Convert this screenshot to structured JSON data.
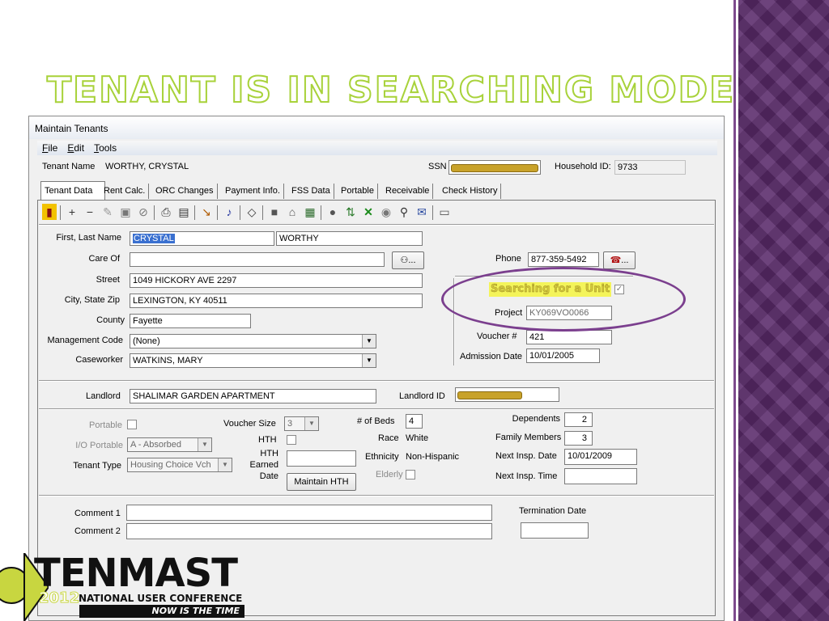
{
  "slide": {
    "title": "Tenant is in Searching Mode"
  },
  "window": {
    "title": "Maintain Tenants"
  },
  "menu": [
    "File",
    "Edit",
    "Tools"
  ],
  "tenant_bar": {
    "name_label": "Tenant Name",
    "name_value": "WORTHY, CRYSTAL",
    "ssn_label": "SSN",
    "household_label": "Household ID:",
    "household_value": "9733"
  },
  "tabs": [
    "Tenant Data",
    "Rent Calc.",
    "ORC Changes",
    "Payment Info.",
    "FSS Data",
    "Portable",
    "Receivable",
    "Check History"
  ],
  "form": {
    "first_last_label": "First, Last Name",
    "first_name": "CRYSTAL",
    "last_name": "WORTHY",
    "care_of_label": "Care Of",
    "care_of_value": "",
    "street_label": "Street",
    "street_value": "1049 HICKORY AVE 2297",
    "city_label": "City, State Zip",
    "city_value": "LEXINGTON, KY 40511",
    "county_label": "County",
    "county_value": "Fayette",
    "mgmt_label": "Management Code",
    "mgmt_value": "(None)",
    "caseworker_label": "Caseworker",
    "caseworker_value": "WATKINS, MARY",
    "phone_label": "Phone",
    "phone_value": "877-359-5492",
    "searching_label": "Searching for a Unit",
    "project_label": "Project",
    "project_value": "KY069VO0066",
    "voucher_label": "Voucher #",
    "voucher_value": "421",
    "admission_label": "Admission Date",
    "admission_value": "10/01/2005",
    "ellipsis": "..."
  },
  "landlord": {
    "label": "Landlord",
    "value": "SHALIMAR GARDEN APARTMENT",
    "id_label": "Landlord ID"
  },
  "details": {
    "portable_label": "Portable",
    "io_portable_label": "I/O Portable",
    "io_portable_value": "A - Absorbed",
    "tenant_type_label": "Tenant Type",
    "tenant_type_value": "Housing Choice Vch",
    "voucher_size_label": "Voucher Size",
    "voucher_size_value": "3",
    "hth_label": "HTH",
    "hth_earned_label_1": "HTH",
    "hth_earned_label_2": "Earned",
    "hth_earned_label_3": "Date",
    "maintain_hth_button": "Maintain HTH",
    "beds_label": "# of Beds",
    "beds_value": "4",
    "race_label": "Race",
    "race_value": "White",
    "ethnicity_label": "Ethnicity",
    "ethnicity_value": "Non-Hispanic",
    "elderly_label": "Elderly",
    "dependents_label": "Dependents",
    "dependents_value": "2",
    "family_label": "Family Members",
    "family_value": "3",
    "next_insp_date_label": "Next Insp. Date",
    "next_insp_date_value": "10/01/2009",
    "next_insp_time_label": "Next Insp. Time",
    "next_insp_time_value": ""
  },
  "comments": {
    "comment1_label": "Comment 1",
    "comment2_label": "Comment 2",
    "termination_label": "Termination Date"
  },
  "logo": {
    "word": "TENMAST",
    "year": "2012",
    "conference": "NATIONAL USER CONFERENCE",
    "tagline": "NOW IS THE TIME"
  },
  "colors": {
    "title_stroke": "#a8d23a",
    "highlight": "#f4f45a",
    "circle": "#7b3f8e",
    "side_band": "#5a2a6a"
  }
}
